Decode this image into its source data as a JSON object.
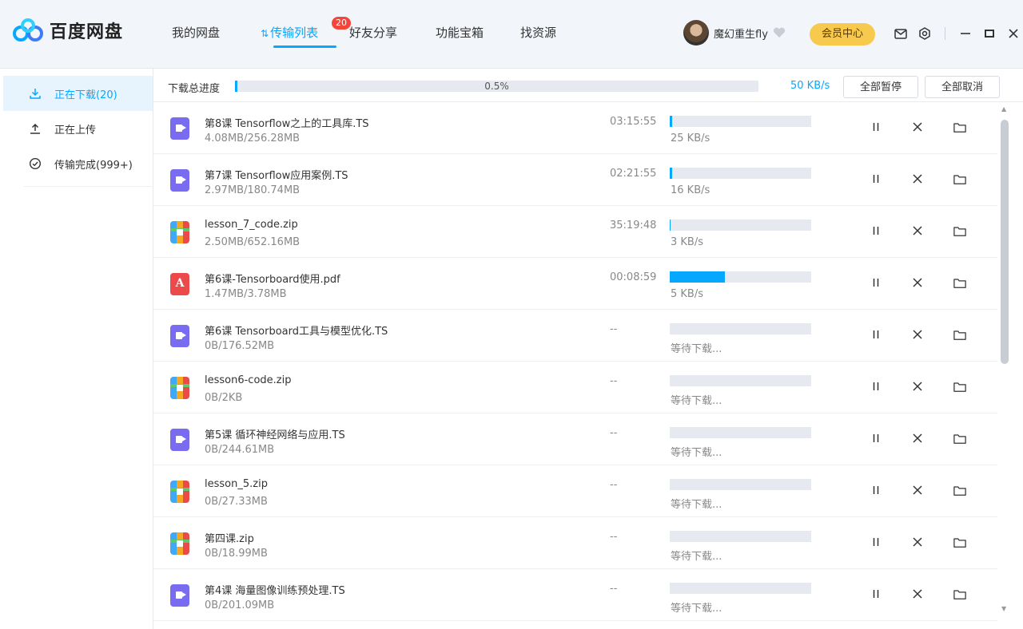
{
  "app": {
    "logo_text": "百度网盘"
  },
  "nav": [
    {
      "label": "我的网盘",
      "active": false
    },
    {
      "label": "传输列表",
      "active": true,
      "badge": "20"
    },
    {
      "label": "好友分享",
      "active": false
    },
    {
      "label": "功能宝箱",
      "active": false
    },
    {
      "label": "找资源",
      "active": false
    }
  ],
  "user": {
    "name": "魔幻重生fly",
    "member_label": "会员中心"
  },
  "sidebar": [
    {
      "label": "正在下载(20)",
      "active": true,
      "icon": "download-icon"
    },
    {
      "label": "正在上传",
      "active": false,
      "icon": "upload-icon"
    },
    {
      "label": "传输完成(999+)",
      "active": false,
      "icon": "check-circle-icon"
    }
  ],
  "progress": {
    "label": "下载总进度",
    "percent_text": "0.5%",
    "percent": 0.005,
    "speed": "50 KB/s",
    "pause_all": "全部暂停",
    "cancel_all": "全部取消"
  },
  "files": [
    {
      "name": "第8课 Tensorflow之上的工具库.TS",
      "size": "4.08MB/256.28MB",
      "time": "03:15:55",
      "status": "25 KB/s",
      "type": "video",
      "progress": 0.016
    },
    {
      "name": "第7课 Tensorflow应用案例.TS",
      "size": "2.97MB/180.74MB",
      "time": "02:21:55",
      "status": "16 KB/s",
      "type": "video",
      "progress": 0.016
    },
    {
      "name": "lesson_7_code.zip",
      "size": "2.50MB/652.16MB",
      "time": "35:19:48",
      "status": "3 KB/s",
      "type": "zip",
      "progress": 0.004
    },
    {
      "name": "第6课-Tensorboard使用.pdf",
      "size": "1.47MB/3.78MB",
      "time": "00:08:59",
      "status": "5 KB/s",
      "type": "pdf",
      "progress": 0.389
    },
    {
      "name": "第6课 Tensorboard工具与模型优化.TS",
      "size": "0B/176.52MB",
      "time": "--",
      "status": "等待下载...",
      "type": "video",
      "progress": 0
    },
    {
      "name": "lesson6-code.zip",
      "size": "0B/2KB",
      "time": "--",
      "status": "等待下载...",
      "type": "zip",
      "progress": 0
    },
    {
      "name": "第5课 循环神经网络与应用.TS",
      "size": "0B/244.61MB",
      "time": "--",
      "status": "等待下载...",
      "type": "video",
      "progress": 0
    },
    {
      "name": "lesson_5.zip",
      "size": "0B/27.33MB",
      "time": "--",
      "status": "等待下载...",
      "type": "zip",
      "progress": 0
    },
    {
      "name": "第四课.zip",
      "size": "0B/18.99MB",
      "time": "--",
      "status": "等待下载...",
      "type": "zip",
      "progress": 0
    },
    {
      "name": "第4课 海量图像训练预处理.TS",
      "size": "0B/201.09MB",
      "time": "--",
      "status": "等待下载...",
      "type": "video",
      "progress": 0
    }
  ],
  "colors": {
    "accent": "#06a7ff",
    "member": "#f7c94c",
    "badge": "#f5453a"
  }
}
